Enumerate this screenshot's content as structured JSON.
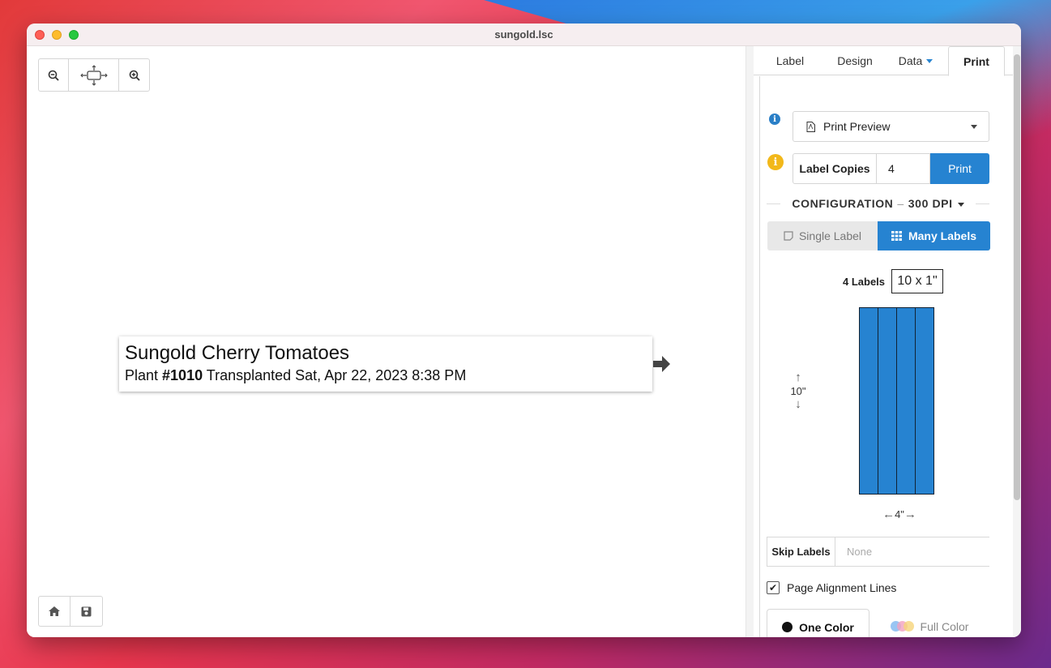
{
  "window": {
    "title": "sungold.lsc"
  },
  "label": {
    "line1": "Sungold Cherry Tomatoes",
    "line2_prefix": "Plant ",
    "line2_bold": "#1010",
    "line2_suffix": " Transplanted Sat, Apr 22, 2023 8:38 PM"
  },
  "tabs": [
    {
      "label": "Label"
    },
    {
      "label": "Design"
    },
    {
      "label": "Data"
    },
    {
      "label": "Print"
    }
  ],
  "print": {
    "preview_select": "Print Preview",
    "copies_label": "Label Copies",
    "copies_value": "4",
    "print_button": "Print",
    "config_title": "CONFIGURATION",
    "config_dpi": "300 DPI",
    "mode_single": "Single Label",
    "mode_many": "Many Labels",
    "labels_count": "4 Labels",
    "label_size": "10 x 1\"",
    "sheet_columns": 4,
    "sheet_height": "10\"",
    "sheet_width": "4\"",
    "skip_label": "Skip Labels",
    "skip_placeholder": "None",
    "alignment_lines": "Page Alignment Lines",
    "alignment_checked": true,
    "color_one": "One Color",
    "color_full": "Full Color"
  },
  "colors": {
    "accent": "#2683d1",
    "info_blue": "#2a7fc7",
    "info_yellow": "#f2b81a"
  }
}
